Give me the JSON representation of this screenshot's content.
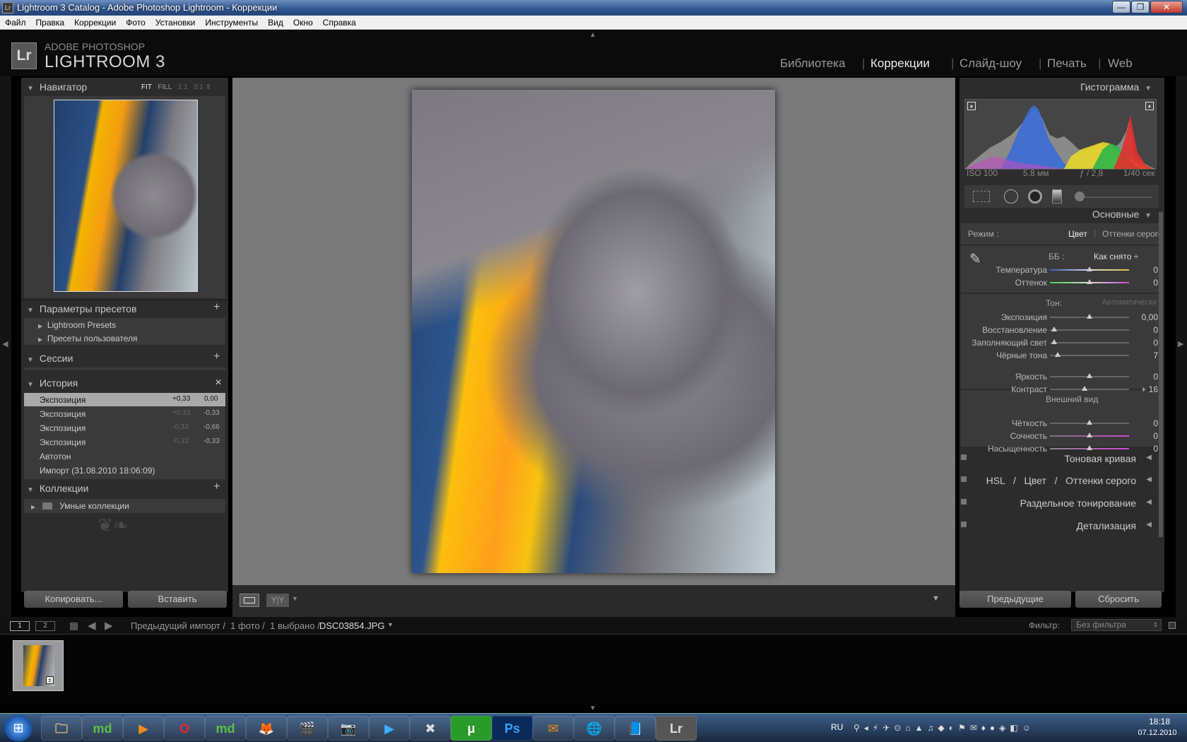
{
  "window": {
    "title": "Lightroom 3 Catalog - Adobe Photoshop Lightroom - Коррекции",
    "min": "—",
    "max": "❐",
    "close": "✕"
  },
  "menu": [
    "Файл",
    "Правка",
    "Коррекции",
    "Фото",
    "Установки",
    "Инструменты",
    "Вид",
    "Окно",
    "Справка"
  ],
  "brand": {
    "logo": "Lr",
    "line1": "ADOBE PHOTOSHOP",
    "line2": "LIGHTROOM 3"
  },
  "modules": [
    {
      "label": "Библиотека",
      "active": false
    },
    {
      "label": "Коррекции",
      "active": true
    },
    {
      "label": "Слайд-шоу",
      "active": false
    },
    {
      "label": "Печать",
      "active": false
    },
    {
      "label": "Web",
      "active": false
    }
  ],
  "navigator": {
    "title": "Навигатор",
    "zoom": [
      "FIT",
      "FILL",
      "1:1",
      "3:1"
    ]
  },
  "presets": {
    "title": "Параметры пресетов",
    "plus": "+",
    "items": [
      "Lightroom Presets",
      "Пресеты пользователя"
    ]
  },
  "sessions": {
    "title": "Сессии",
    "plus": "+"
  },
  "history": {
    "title": "История",
    "close": "✕",
    "items": [
      {
        "name": "Экспозиция",
        "delta": "+0,33",
        "value": "0,00",
        "selected": true
      },
      {
        "name": "Экспозиция",
        "delta": "+0,33",
        "value": "-0,33",
        "selected": false
      },
      {
        "name": "Экспозиция",
        "delta": "-0,33",
        "value": "-0,66",
        "selected": false
      },
      {
        "name": "Экспозиция",
        "delta": "-0,33",
        "value": "-0,33",
        "selected": false
      },
      {
        "name": "Автотон",
        "delta": "",
        "value": "",
        "selected": false
      },
      {
        "name": "Импорт (31.08.2010 18:06:09)",
        "delta": "",
        "value": "",
        "selected": false
      }
    ]
  },
  "collections": {
    "title": "Коллекции",
    "plus": "+",
    "items": [
      "Умные коллекции"
    ]
  },
  "left_buttons": {
    "copy": "Копировать...",
    "paste": "Вставить"
  },
  "toolbar": {
    "yy": "Y|Y"
  },
  "histogram": {
    "title": "Гистограмма",
    "iso": "ISO 100",
    "focal": "5.8 мм",
    "aperture": "ƒ / 2,8",
    "shutter": "1/40 сек"
  },
  "basic": {
    "title": "Основные",
    "mode_label": "Режим :",
    "mode_color": "Цвет",
    "mode_gray": "Оттенки серого",
    "wb_label": "ББ :",
    "wb_value": "Как снято ÷",
    "tone_label": "Тон:",
    "auto": "Автоматически",
    "presence_label": "Внешний вид",
    "sliders_wb": [
      {
        "name": "Температура",
        "value": "0",
        "pos": 0.5
      },
      {
        "name": "Оттенок",
        "value": "0",
        "pos": 0.5
      }
    ],
    "sliders_tone": [
      {
        "name": "Экспозиция",
        "value": "0,00",
        "pos": 0.5
      },
      {
        "name": "Восстановление",
        "value": "0",
        "pos": 0.05
      },
      {
        "name": "Заполняющий свет",
        "value": "0",
        "pos": 0.05
      },
      {
        "name": "Чёрные тона",
        "value": "7",
        "pos": 0.1
      },
      {
        "name": "Яркость",
        "value": "0",
        "pos": 0.5
      },
      {
        "name": "Контраст",
        "value": "+ 16",
        "pos": 0.44
      }
    ],
    "sliders_presence": [
      {
        "name": "Чёткость",
        "value": "0",
        "pos": 0.5
      },
      {
        "name": "Сочность",
        "value": "0",
        "pos": 0.5
      },
      {
        "name": "Насыщенность",
        "value": "0",
        "pos": 0.5
      }
    ]
  },
  "collapsed_panels": [
    {
      "label": "Тоновая кривая"
    },
    {
      "label": "HSL   /   Цвет   /   Оттенки серого"
    },
    {
      "label": "Раздельное тонирование"
    },
    {
      "label": "Детализация"
    }
  ],
  "right_buttons": {
    "prev": "Предыдущие",
    "reset": "Сбросить"
  },
  "filmstrip": {
    "pages": [
      "1",
      "2"
    ],
    "path": "Предыдущий импорт /  1 фото /  1 выбрано / ",
    "filename": "DSC03854.JPG",
    "filter_label": "Фильтр:",
    "filter_value": "Без фильтра"
  },
  "taskbar": {
    "apps": [
      "md",
      "▶",
      "O",
      "md",
      "🦊",
      "🎬",
      "📷",
      "▶",
      "✖",
      "μ",
      "Ps",
      "✉",
      "🌐",
      "📘",
      "Lr"
    ],
    "lang": "RU",
    "time": "18:18",
    "date": "07.12.2010"
  }
}
